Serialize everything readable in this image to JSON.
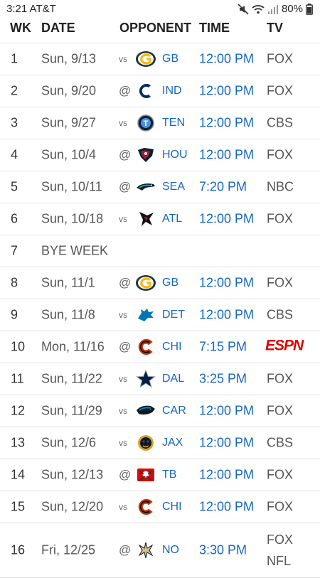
{
  "status_bar": {
    "time": "3:21",
    "carrier": "AT&T",
    "battery": "80%"
  },
  "columns": {
    "wk": "WK",
    "date": "DATE",
    "opponent": "OPPONENT",
    "time": "TIME",
    "tv": "TV"
  },
  "games": [
    {
      "wk": "1",
      "date": "Sun, 9/13",
      "ha": "vs",
      "logo": "packers-logo",
      "opp": "GB",
      "time": "12:00 PM",
      "tv": "FOX"
    },
    {
      "wk": "2",
      "date": "Sun, 9/20",
      "ha": "@",
      "logo": "colts-logo",
      "opp": "IND",
      "time": "12:00 PM",
      "tv": "FOX"
    },
    {
      "wk": "3",
      "date": "Sun, 9/27",
      "ha": "vs",
      "logo": "titans-logo",
      "opp": "TEN",
      "time": "12:00 PM",
      "tv": "CBS"
    },
    {
      "wk": "4",
      "date": "Sun, 10/4",
      "ha": "@",
      "logo": "texans-logo",
      "opp": "HOU",
      "time": "12:00 PM",
      "tv": "FOX"
    },
    {
      "wk": "5",
      "date": "Sun, 10/11",
      "ha": "@",
      "logo": "seahawks-logo",
      "opp": "SEA",
      "time": "7:20 PM",
      "tv": "NBC"
    },
    {
      "wk": "6",
      "date": "Sun, 10/18",
      "ha": "vs",
      "logo": "falcons-logo",
      "opp": "ATL",
      "time": "12:00 PM",
      "tv": "FOX"
    },
    {
      "wk": "7",
      "bye": "BYE WEEK"
    },
    {
      "wk": "8",
      "date": "Sun, 11/1",
      "ha": "@",
      "logo": "packers-logo",
      "opp": "GB",
      "time": "12:00 PM",
      "tv": "FOX"
    },
    {
      "wk": "9",
      "date": "Sun, 11/8",
      "ha": "vs",
      "logo": "lions-logo",
      "opp": "DET",
      "time": "12:00 PM",
      "tv": "CBS"
    },
    {
      "wk": "10",
      "date": "Mon, 11/16",
      "ha": "@",
      "logo": "bears-logo",
      "opp": "CHI",
      "time": "7:15 PM",
      "tv": "ESPN",
      "tv_logo": "espn-logo"
    },
    {
      "wk": "11",
      "date": "Sun, 11/22",
      "ha": "vs",
      "logo": "cowboys-logo",
      "opp": "DAL",
      "time": "3:25 PM",
      "tv": "FOX"
    },
    {
      "wk": "12",
      "date": "Sun, 11/29",
      "ha": "vs",
      "logo": "panthers-logo",
      "opp": "CAR",
      "time": "12:00 PM",
      "tv": "FOX"
    },
    {
      "wk": "13",
      "date": "Sun, 12/6",
      "ha": "vs",
      "logo": "jaguars-logo",
      "opp": "JAX",
      "time": "12:00 PM",
      "tv": "CBS"
    },
    {
      "wk": "14",
      "date": "Sun, 12/13",
      "ha": "@",
      "logo": "buccaneers-logo",
      "opp": "TB",
      "time": "12:00 PM",
      "tv": "FOX"
    },
    {
      "wk": "15",
      "date": "Sun, 12/20",
      "ha": "vs",
      "logo": "bears-logo",
      "opp": "CHI",
      "time": "12:00 PM",
      "tv": "FOX"
    },
    {
      "wk": "16",
      "date": "Fri, 12/25",
      "ha": "@",
      "logo": "saints-logo",
      "opp": "NO",
      "time": "3:30 PM",
      "tv": "FOX",
      "tv_extra": "NFL"
    }
  ]
}
